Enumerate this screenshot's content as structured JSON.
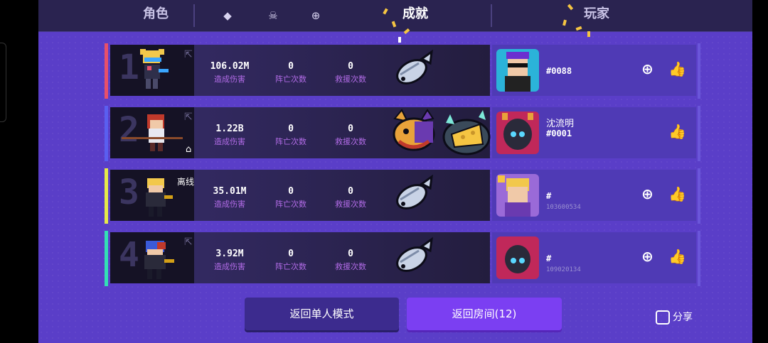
{
  "tabs": {
    "role": "角色",
    "achievement": "成就",
    "player": "玩家",
    "icons": [
      "tag-icon",
      "skull-icon",
      "target-icon"
    ]
  },
  "stat_labels": {
    "damage": "造成伤害",
    "deaths": "阵亡次数",
    "rescues": "救援次数"
  },
  "rows": [
    {
      "rank": "1",
      "color": "#e8506a",
      "damage": "106.02M",
      "deaths": "0",
      "rescues": "0",
      "badges": [
        "fish-badge"
      ],
      "player_name": "",
      "player_id": "#0088",
      "player_sub": "",
      "offline": "",
      "has_add_friend": true
    },
    {
      "rank": "2",
      "color": "#5a5ff0",
      "damage": "1.22B",
      "deaths": "0",
      "rescues": "0",
      "badges": [
        "wolf-badge",
        "cheese-badge"
      ],
      "player_name": "沈流明",
      "player_id": "#0001",
      "player_sub": "",
      "offline": "",
      "has_add_friend": false
    },
    {
      "rank": "3",
      "color": "#e7e94a",
      "damage": "35.01M",
      "deaths": "0",
      "rescues": "0",
      "badges": [
        "fish-badge"
      ],
      "player_name": "",
      "player_id": "#",
      "player_sub": "103600534",
      "offline": "离线",
      "has_add_friend": true
    },
    {
      "rank": "4",
      "color": "#33e0b5",
      "damage": "3.92M",
      "deaths": "0",
      "rescues": "0",
      "badges": [
        "fish-badge"
      ],
      "player_name": "",
      "player_id": "#",
      "player_sub": "109020134",
      "offline": "",
      "has_add_friend": true
    }
  ],
  "buttons": {
    "single_mode": "返回单人模式",
    "room": "返回房间(12)",
    "share": "分享"
  }
}
